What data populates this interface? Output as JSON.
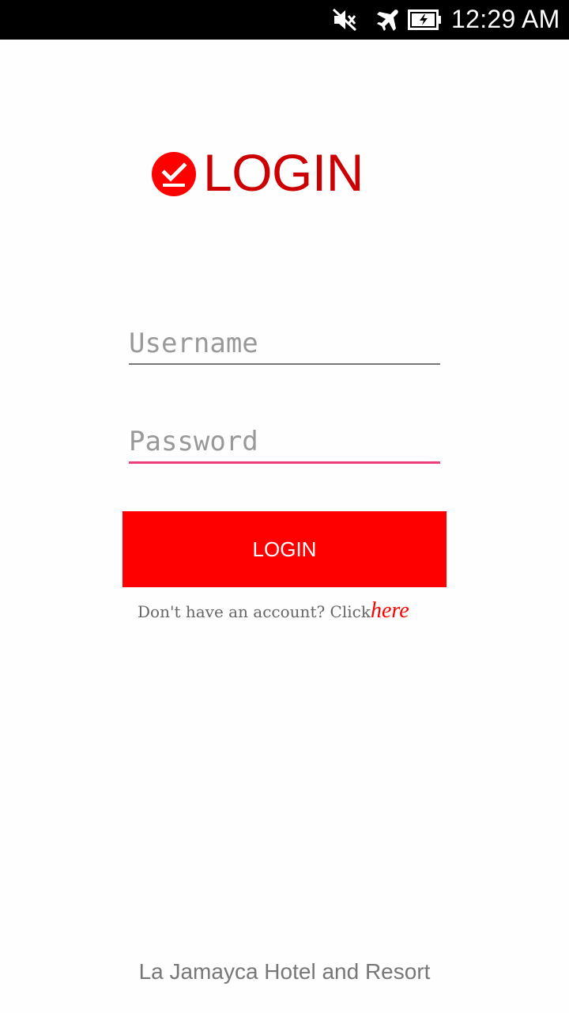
{
  "status_bar": {
    "time": "12:29 AM",
    "icons": [
      "mute-icon",
      "airplane-mode-icon",
      "battery-charging-icon"
    ]
  },
  "header": {
    "logo_icon": "check-circle-icon",
    "title": "LOGIN"
  },
  "form": {
    "username_placeholder": "Username",
    "username_value": "",
    "password_placeholder": "Password",
    "password_value": "",
    "submit_label": "LOGIN"
  },
  "signup": {
    "prompt": "Don't have an account? Click",
    "link_label": "here"
  },
  "footer": {
    "text": "La Jamayca Hotel and Resort"
  },
  "colors": {
    "accent": "#ff0000",
    "title": "#cc0000",
    "focus_underline": "#ee3f7a"
  }
}
